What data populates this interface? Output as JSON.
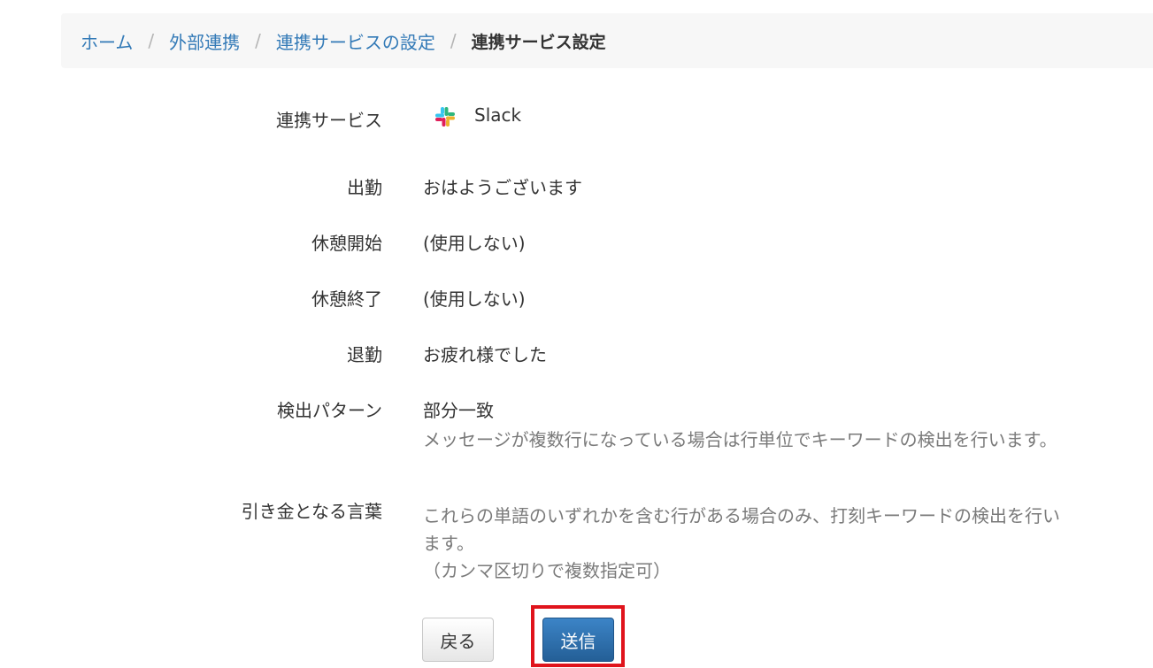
{
  "breadcrumb": {
    "items": [
      {
        "label": "ホーム"
      },
      {
        "label": "外部連携"
      },
      {
        "label": "連携サービスの設定"
      }
    ],
    "separator": "/",
    "current": "連携サービス設定"
  },
  "form": {
    "service": {
      "label": "連携サービス",
      "value": "Slack",
      "icon": "slack-icon"
    },
    "clock_in": {
      "label": "出勤",
      "value": "おはようございます"
    },
    "break_start": {
      "label": "休憩開始",
      "value": "(使用しない)"
    },
    "break_end": {
      "label": "休憩終了",
      "value": "(使用しない)"
    },
    "clock_out": {
      "label": "退勤",
      "value": "お疲れ様でした"
    },
    "detection": {
      "label": "検出パターン",
      "value": "部分一致",
      "help": "メッセージが複数行になっている場合は行単位でキーワードの検出を行います。"
    },
    "trigger": {
      "label": "引き金となる言葉",
      "help_line1": "これらの単語のいずれかを含む行がある場合のみ、打刻キーワードの検出を行い",
      "help_line2": "ます。",
      "help_line3": "（カンマ区切りで複数指定可）"
    }
  },
  "buttons": {
    "back": "戻る",
    "submit": "送信"
  },
  "colors": {
    "link": "#337ab7",
    "primary": "#2d6ca8",
    "highlight": "#e0141c"
  }
}
